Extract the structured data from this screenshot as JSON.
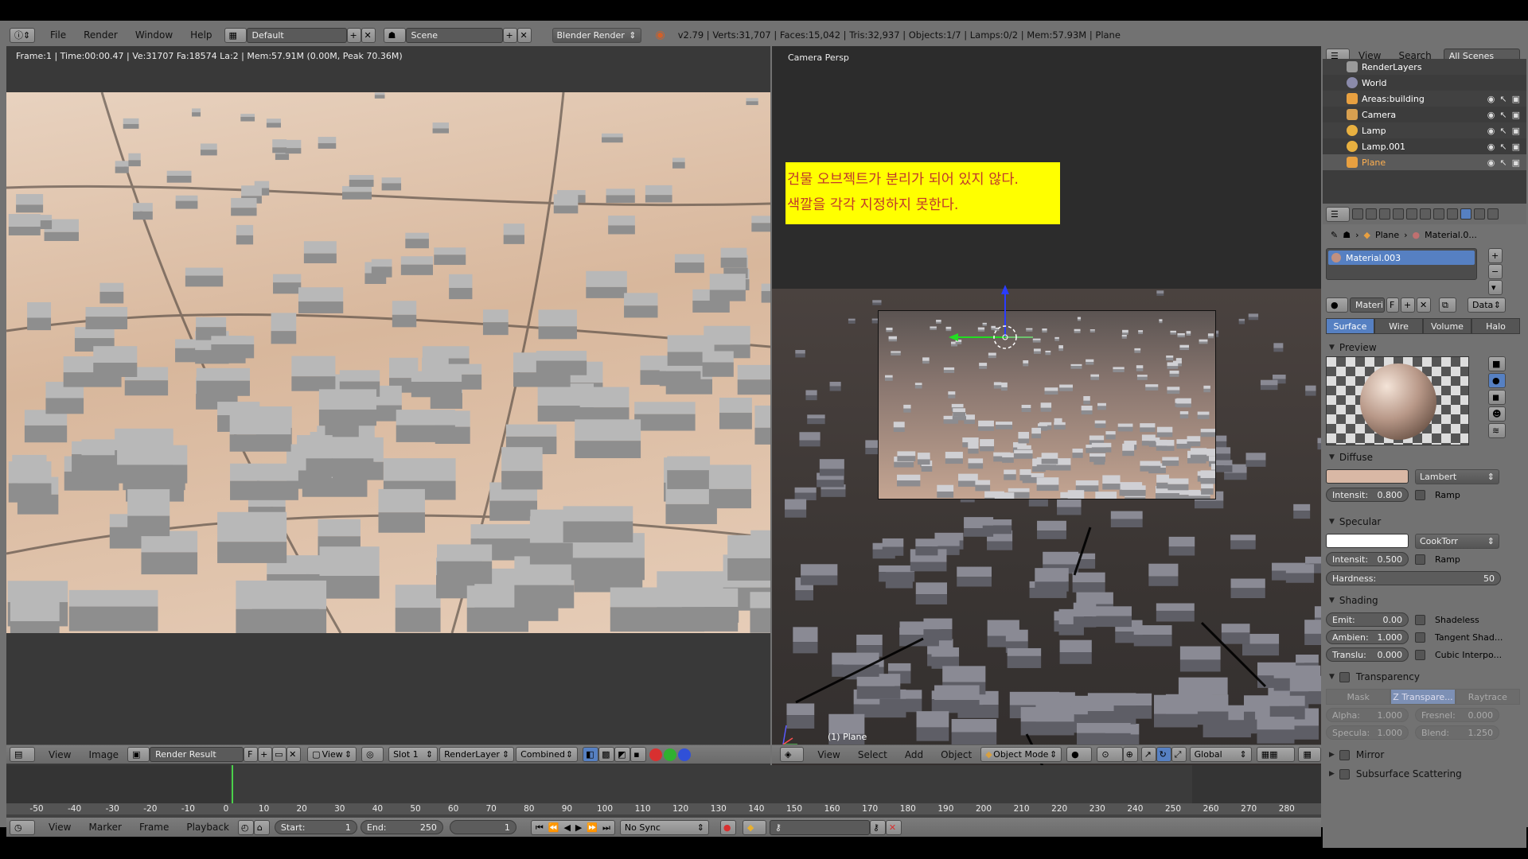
{
  "topbar": {
    "menus": [
      "File",
      "Render",
      "Window",
      "Help"
    ],
    "layout": "Default",
    "scene": "Scene",
    "engine": "Blender Render",
    "stats": "v2.79 | Verts:31,707 | Faces:15,042 | Tris:32,937 | Objects:1/7 | Lamps:0/2 | Mem:57.93M | Plane"
  },
  "image_editor": {
    "meta": "Frame:1 | Time:00:00.47 | Ve:31707 Fa:18574 La:2 | Mem:57.91M (0.00M, Peak 70.36M)",
    "header": {
      "menus": [
        "View",
        "Image"
      ],
      "image_name": "Render Result",
      "fake_user": "F",
      "view_label": "View",
      "slot": "Slot 1",
      "layer": "RenderLayer",
      "pass": "Combined"
    }
  },
  "viewport": {
    "label": "Camera Persp",
    "object_label": "(1) Plane",
    "note": {
      "line1": "건물 오브젝트가 분리가 되어 있지 않다.",
      "line2": "색깔을 각각 지정하지 못한다."
    },
    "header": {
      "menus": [
        "View",
        "Select",
        "Add",
        "Object"
      ],
      "mode": "Object Mode",
      "orientation": "Global"
    }
  },
  "timeline": {
    "ticks": [
      "-50",
      "-40",
      "-30",
      "-20",
      "-10",
      "0",
      "10",
      "20",
      "30",
      "40",
      "50",
      "60",
      "70",
      "80",
      "90",
      "100",
      "110",
      "120",
      "130",
      "140",
      "150",
      "160",
      "170",
      "180",
      "190",
      "200",
      "210",
      "220",
      "230",
      "240",
      "250",
      "260",
      "270",
      "280"
    ],
    "header": {
      "menus": [
        "View",
        "Marker",
        "Frame",
        "Playback"
      ],
      "start_label": "Start:",
      "start": "1",
      "end_label": "End:",
      "end": "250",
      "current": "1",
      "sync": "No Sync"
    }
  },
  "outliner": {
    "menus": [
      "View",
      "Search"
    ],
    "filter": "All Scenes",
    "items": [
      {
        "name": "RenderLayers",
        "color": "#9a9a9a"
      },
      {
        "name": "World",
        "color": "#8a8aaa"
      },
      {
        "name": "Areas:building",
        "color": "#e8a040"
      },
      {
        "name": "Camera",
        "color": "#d8a050"
      },
      {
        "name": "Lamp",
        "color": "#e8b040"
      },
      {
        "name": "Lamp.001",
        "color": "#e8b040"
      },
      {
        "name": "Plane",
        "color": "#e8a040"
      }
    ]
  },
  "properties": {
    "breadcrumb": {
      "object": "Plane",
      "material": "Material.0..."
    },
    "slot_name": "Material.003",
    "material_field": "Materi",
    "fake_user": "F",
    "link": "Data",
    "tabs": [
      "Surface",
      "Wire",
      "Volume",
      "Halo"
    ],
    "preview_title": "Preview",
    "diffuse": {
      "title": "Diffuse",
      "color": "#d9b8a5",
      "shader": "Lambert",
      "intensity_label": "Intensit:",
      "intensity": "0.800",
      "ramp": "Ramp"
    },
    "specular": {
      "title": "Specular",
      "color": "#ffffff",
      "shader": "CookTorr",
      "intensity_label": "Intensit:",
      "intensity": "0.500",
      "ramp": "Ramp",
      "hardness_label": "Hardness:",
      "hardness": "50"
    },
    "shading": {
      "title": "Shading",
      "emit_label": "Emit:",
      "emit": "0.00",
      "ambient_label": "Ambien:",
      "ambient": "1.000",
      "translucency_label": "Translu:",
      "translucency": "0.000",
      "shadeless": "Shadeless",
      "tangent": "Tangent Shad...",
      "cubic": "Cubic Interpo..."
    },
    "transparency": {
      "title": "Transparency",
      "tabs": [
        "Mask",
        "Z Transpare...",
        "Raytrace"
      ],
      "alpha_label": "Alpha:",
      "alpha": "1.000",
      "fresnel_label": "Fresnel:",
      "fresnel": "0.000",
      "specular_label": "Specula:",
      "specular": "1.000",
      "blend_label": "Blend:",
      "blend": "1.250"
    },
    "mirror_title": "Mirror",
    "sss_title": "Subsurface Scattering"
  }
}
